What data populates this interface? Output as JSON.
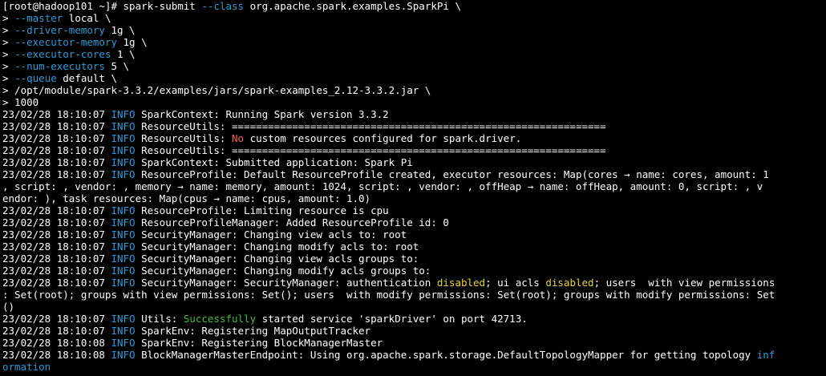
{
  "colors": {
    "background": "#000000",
    "text": "#ffffff",
    "blue": "#2e9bd6",
    "red": "#f0624f",
    "yellow": "#e6d72e",
    "green": "#3fbf3f"
  },
  "lines": [
    [
      {
        "t": "[root@hadoop101 ~]# spark-submit "
      },
      {
        "t": "--class",
        "c": "blue"
      },
      {
        "t": " org.apache.spark.examples.SparkPi \\"
      }
    ],
    [
      {
        "t": "> "
      },
      {
        "t": "--master",
        "c": "blue"
      },
      {
        "t": " local \\"
      }
    ],
    [
      {
        "t": "> "
      },
      {
        "t": "--driver-memory",
        "c": "blue"
      },
      {
        "t": " 1g \\"
      }
    ],
    [
      {
        "t": "> "
      },
      {
        "t": "--executor-memory",
        "c": "blue"
      },
      {
        "t": " 1g \\"
      }
    ],
    [
      {
        "t": "> "
      },
      {
        "t": "--executor-cores",
        "c": "blue"
      },
      {
        "t": " 1 \\"
      }
    ],
    [
      {
        "t": "> "
      },
      {
        "t": "--num-executors",
        "c": "blue"
      },
      {
        "t": " 5 \\"
      }
    ],
    [
      {
        "t": "> "
      },
      {
        "t": "--queue",
        "c": "blue"
      },
      {
        "t": " default \\"
      }
    ],
    [
      {
        "t": "> /opt/module/spark-3.3.2/examples/jars/spark-examples_2.12-3.3.2.jar \\"
      }
    ],
    [
      {
        "t": "> 1000"
      }
    ],
    [
      {
        "t": "23/02/28 18:10:07 "
      },
      {
        "t": "INFO",
        "c": "blue"
      },
      {
        "t": " SparkContext: Running Spark version 3.3.2"
      }
    ],
    [
      {
        "t": "23/02/28 18:10:07 "
      },
      {
        "t": "INFO",
        "c": "blue"
      },
      {
        "t": " ResourceUtils: =============================================================="
      }
    ],
    [
      {
        "t": "23/02/28 18:10:07 "
      },
      {
        "t": "INFO",
        "c": "blue"
      },
      {
        "t": " ResourceUtils: "
      },
      {
        "t": "No",
        "c": "red"
      },
      {
        "t": " custom resources configured for spark.driver."
      }
    ],
    [
      {
        "t": "23/02/28 18:10:07 "
      },
      {
        "t": "INFO",
        "c": "blue"
      },
      {
        "t": " ResourceUtils: =============================================================="
      }
    ],
    [
      {
        "t": "23/02/28 18:10:07 "
      },
      {
        "t": "INFO",
        "c": "blue"
      },
      {
        "t": " SparkContext: Submitted application: Spark Pi"
      }
    ],
    [
      {
        "t": "23/02/28 18:10:07 "
      },
      {
        "t": "INFO",
        "c": "blue"
      },
      {
        "t": " ResourceProfile: Default ResourceProfile created, executor resources: Map(cores → name: cores, amount: 1"
      }
    ],
    [
      {
        "t": ", script: , vendor: , memory → name: memory, amount: 1024, script: , vendor: , offHeap → name: offHeap, amount: 0, script: , v"
      }
    ],
    [
      {
        "t": "endor: ), task resources: Map(cpus → name: cpus, amount: 1.0)"
      }
    ],
    [
      {
        "t": "23/02/28 18:10:07 "
      },
      {
        "t": "INFO",
        "c": "blue"
      },
      {
        "t": " ResourceProfile: Limiting resource is cpu"
      }
    ],
    [
      {
        "t": "23/02/28 18:10:07 "
      },
      {
        "t": "INFO",
        "c": "blue"
      },
      {
        "t": " ResourceProfileManager: Added ResourceProfile id: 0"
      }
    ],
    [
      {
        "t": "23/02/28 18:10:07 "
      },
      {
        "t": "INFO",
        "c": "blue"
      },
      {
        "t": " SecurityManager: Changing view acls to: root"
      }
    ],
    [
      {
        "t": "23/02/28 18:10:07 "
      },
      {
        "t": "INFO",
        "c": "blue"
      },
      {
        "t": " SecurityManager: Changing modify acls to: root"
      }
    ],
    [
      {
        "t": "23/02/28 18:10:07 "
      },
      {
        "t": "INFO",
        "c": "blue"
      },
      {
        "t": " SecurityManager: Changing view acls groups to:"
      }
    ],
    [
      {
        "t": "23/02/28 18:10:07 "
      },
      {
        "t": "INFO",
        "c": "blue"
      },
      {
        "t": " SecurityManager: Changing modify acls groups to:"
      }
    ],
    [
      {
        "t": "23/02/28 18:10:07 "
      },
      {
        "t": "INFO",
        "c": "blue"
      },
      {
        "t": " SecurityManager: SecurityManager: authentication "
      },
      {
        "t": "disabled",
        "c": "yellow"
      },
      {
        "t": "; ui acls "
      },
      {
        "t": "disabled",
        "c": "yellow"
      },
      {
        "t": "; users  with view permissions"
      }
    ],
    [
      {
        "t": ": Set(root); groups with view permissions: Set(); users  with modify permissions: Set(root); groups with modify permissions: Set"
      }
    ],
    [
      {
        "t": "()"
      }
    ],
    [
      {
        "t": "23/02/28 18:10:07 "
      },
      {
        "t": "INFO",
        "c": "blue"
      },
      {
        "t": " Utils: "
      },
      {
        "t": "Successfully",
        "c": "green"
      },
      {
        "t": " started service 'sparkDriver' on port 42713."
      }
    ],
    [
      {
        "t": "23/02/28 18:10:07 "
      },
      {
        "t": "INFO",
        "c": "blue"
      },
      {
        "t": " SparkEnv: Registering MapOutputTracker"
      }
    ],
    [
      {
        "t": "23/02/28 18:10:08 "
      },
      {
        "t": "INFO",
        "c": "blue"
      },
      {
        "t": " SparkEnv: Registering BlockManagerMaster"
      }
    ],
    [
      {
        "t": "23/02/28 18:10:08 "
      },
      {
        "t": "INFO",
        "c": "blue"
      },
      {
        "t": " BlockManagerMasterEndpoint: Using org.apache.spark.storage.DefaultTopologyMapper for getting topology "
      },
      {
        "t": "inf",
        "c": "blue"
      }
    ],
    [
      {
        "t": "ormation",
        "c": "blue"
      }
    ]
  ]
}
